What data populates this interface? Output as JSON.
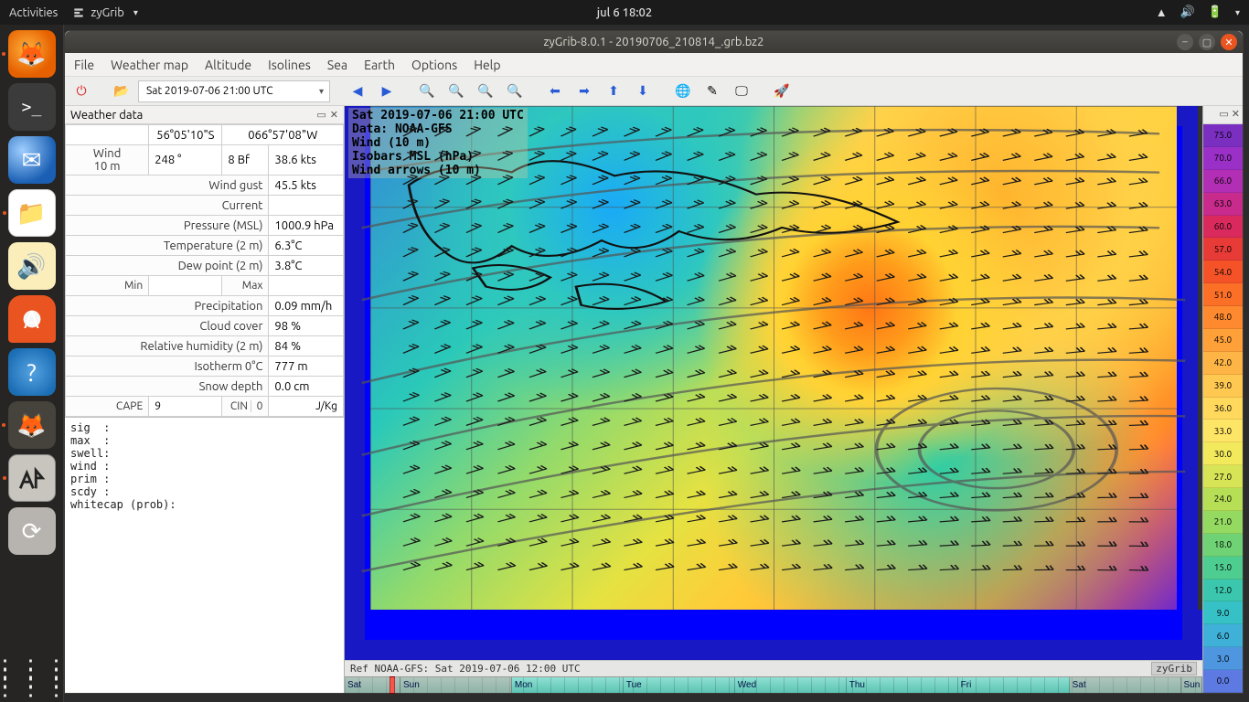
{
  "topbar": {
    "activities": "Activities",
    "app_name": "zyGrib",
    "clock": "jul 6  18:02"
  },
  "window": {
    "title": "zyGrib-8.0.1 - 20190706_210814_.grb.bz2"
  },
  "menubar": [
    "File",
    "Weather map",
    "Altitude",
    "Isolines",
    "Sea",
    "Earth",
    "Options",
    "Help"
  ],
  "toolbar": {
    "date_selected": "Sat 2019-07-06 21:00 UTC"
  },
  "panel_title": "Weather data",
  "coords": {
    "lat": "56°05'10\"S",
    "lon": "066°57'08\"W"
  },
  "wind": {
    "label": "Wind\n10 m",
    "dir": "248 °",
    "bf": "8 Bf",
    "speed": "38.6  kts"
  },
  "rows": {
    "gust_l": "Wind gust",
    "gust_v": "45.5  kts",
    "current_l": "Current",
    "current_v": "",
    "press_l": "Pressure (MSL)",
    "press_v": "1000.9 hPa",
    "temp_l": "Temperature (2 m)",
    "temp_v": "6.3°C",
    "dew_l": "Dew point (2 m)",
    "dew_v": "3.8°C",
    "min_l": "Min",
    "min_v": "",
    "max_l": "Max",
    "max_v": "",
    "prec_l": "Precipitation",
    "prec_v": "0.09 mm/h",
    "cloud_l": "Cloud cover",
    "cloud_v": "98 %",
    "rh_l": "Relative humidity (2 m)",
    "rh_v": "84 %",
    "iso_l": "Isotherm 0°C",
    "iso_v": "777 m",
    "snow_l": "Snow depth",
    "snow_v": "0.0 cm",
    "cape_l": "CAPE",
    "cape_v": "9",
    "cin_l": "CIN",
    "cin_v": "0",
    "cin_u": "J/Kg"
  },
  "bottomtext": "sig  :\nmax  :\nswell:\nwind :\nprim :\nscdy :\nwhitecap (prob):",
  "overlay": {
    "l1": "Sat 2019-07-06 21:00 UTC",
    "l2": "Data: NOAA-GFS",
    "l3": "Wind (10 m)",
    "l4": "Isobars MSL (hPa)",
    "l5": "Wind arrows (10 m)"
  },
  "statusbar": {
    "ref": "Ref NOAA-GFS: Sat 2019-07-06 12:00 UTC",
    "brand": "zyGrib"
  },
  "timeline_days": [
    {
      "label": "Sat",
      "weekend": true,
      "w": 6.5
    },
    {
      "label": "Sun",
      "weekend": true,
      "w": 13
    },
    {
      "label": "Mon",
      "weekend": false,
      "w": 13
    },
    {
      "label": "Tue",
      "weekend": false,
      "w": 13
    },
    {
      "label": "Wed",
      "weekend": false,
      "w": 13
    },
    {
      "label": "Thu",
      "weekend": false,
      "w": 13
    },
    {
      "label": "Fri",
      "weekend": false,
      "w": 13
    },
    {
      "label": "Sat",
      "weekend": true,
      "w": 13
    },
    {
      "label": "Sun",
      "weekend": true,
      "w": 2.5
    }
  ],
  "scale": [
    {
      "v": "75.0",
      "c": "#7a2fc1"
    },
    {
      "v": "70.0",
      "c": "#9a30c7"
    },
    {
      "v": "66.0",
      "c": "#b22fb5"
    },
    {
      "v": "63.0",
      "c": "#c82b8c"
    },
    {
      "v": "60.0",
      "c": "#da2a5d"
    },
    {
      "v": "57.0",
      "c": "#e83a36"
    },
    {
      "v": "54.0",
      "c": "#f55327"
    },
    {
      "v": "51.0",
      "c": "#fb6f27"
    },
    {
      "v": "48.0",
      "c": "#ff892e"
    },
    {
      "v": "45.0",
      "c": "#ffa038"
    },
    {
      "v": "42.0",
      "c": "#ffb545"
    },
    {
      "v": "39.0",
      "c": "#ffc851"
    },
    {
      "v": "36.0",
      "c": "#ffd85c"
    },
    {
      "v": "33.0",
      "c": "#ffe566"
    },
    {
      "v": "30.0",
      "c": "#f2e95d"
    },
    {
      "v": "27.0",
      "c": "#d7e456"
    },
    {
      "v": "24.0",
      "c": "#b7df56"
    },
    {
      "v": "21.0",
      "c": "#94d960"
    },
    {
      "v": "18.0",
      "c": "#6fd375"
    },
    {
      "v": "15.0",
      "c": "#4ecd91"
    },
    {
      "v": "12.0",
      "c": "#3ac7ad"
    },
    {
      "v": "9.0",
      "c": "#35c1c6"
    },
    {
      "v": "6.0",
      "c": "#3fb0d8"
    },
    {
      "v": "3.0",
      "c": "#4e97e0"
    },
    {
      "v": "0.0",
      "c": "#5d7ae3"
    }
  ]
}
